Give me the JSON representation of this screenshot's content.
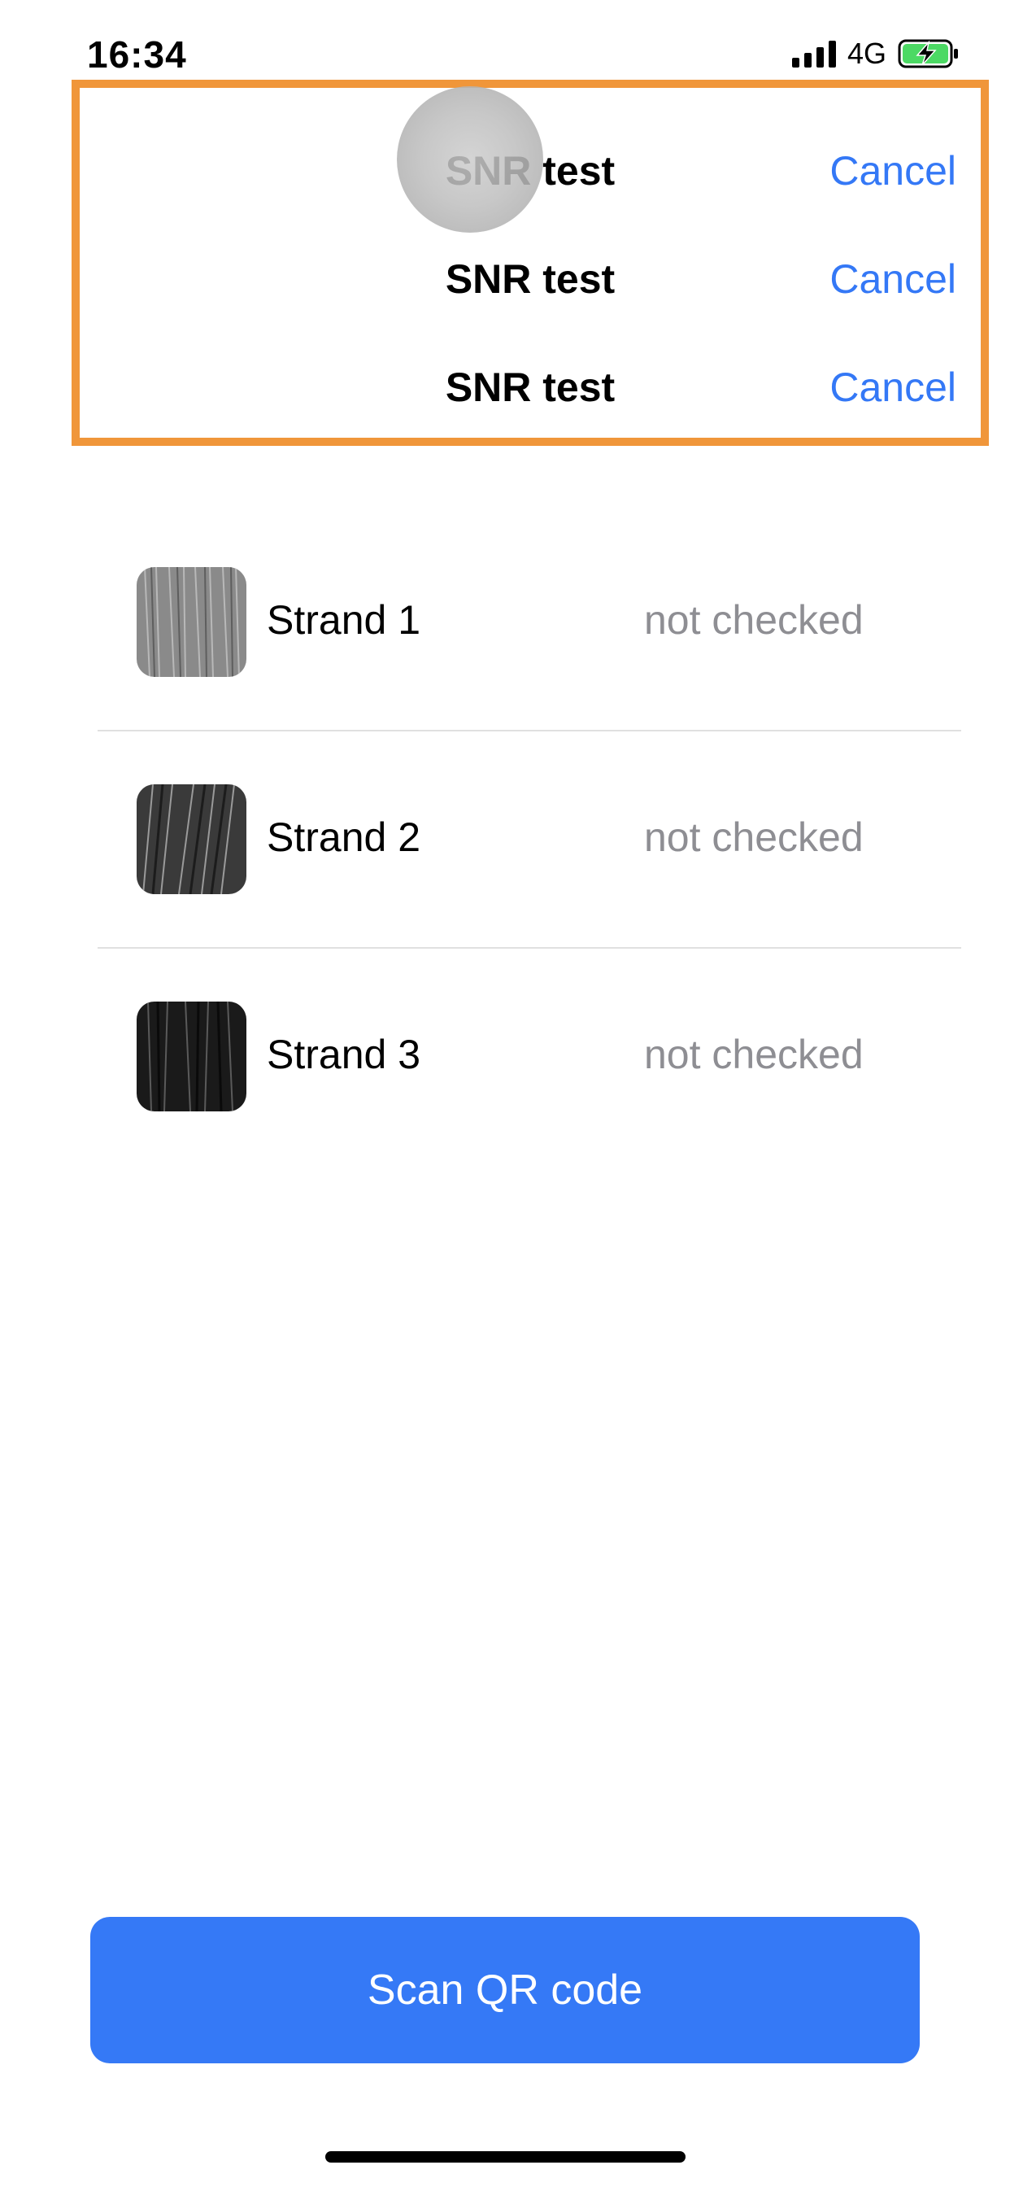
{
  "status_bar": {
    "time": "16:34",
    "network": "4G",
    "icons": [
      "signal-icon",
      "battery-charging-icon"
    ]
  },
  "nav_rows": [
    {
      "title": "SNR test",
      "cancel": "Cancel"
    },
    {
      "title": "SNR test",
      "cancel": "Cancel"
    },
    {
      "title": "SNR test",
      "cancel": "Cancel"
    }
  ],
  "strands": [
    {
      "label": "Strand 1",
      "status": "not checked"
    },
    {
      "label": "Strand 2",
      "status": "not checked"
    },
    {
      "label": "Strand 3",
      "status": "not checked"
    }
  ],
  "scan_button": {
    "label": "Scan QR code"
  },
  "colors": {
    "accent": "#3478f6",
    "highlight": "#f0963a",
    "secondary_text": "#8e8e93",
    "battery_green": "#4cd964"
  }
}
